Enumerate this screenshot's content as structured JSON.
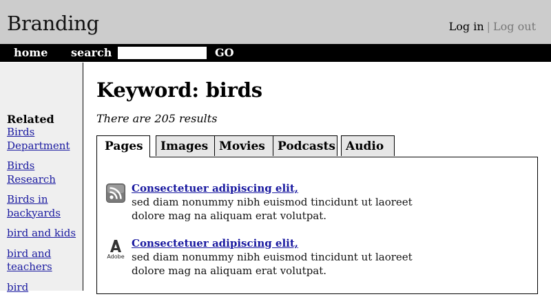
{
  "header": {
    "brand": "Branding",
    "login_label": "Log in",
    "separator": "|",
    "logout_label": "Log out"
  },
  "nav": {
    "home_label": "home",
    "search_label": "search",
    "search_value": "",
    "go_label": "GO"
  },
  "sidebar": {
    "title": "Related",
    "items": [
      {
        "label": "Birds Department"
      },
      {
        "label": "Birds Research"
      },
      {
        "label": "Birds in backyards"
      },
      {
        "label": "bird and kids"
      },
      {
        "label": "bird and teachers"
      },
      {
        "label": "bird"
      }
    ]
  },
  "main": {
    "title": "Keyword: birds",
    "results_count": "There are 205 results",
    "tabs": [
      {
        "label": "Pages"
      },
      {
        "label": "Images"
      },
      {
        "label": "Movies"
      },
      {
        "label": "Podcasts"
      },
      {
        "label": "Audio"
      }
    ],
    "results": [
      {
        "icon": "rss-icon",
        "title": "Consectetuer adipiscing elit,",
        "line1": "sed diam nonummy nibh euismod tincidunt ut laoreet",
        "line2": "dolore mag na aliquam erat volutpat."
      },
      {
        "icon": "adobe-pdf-icon",
        "icon_text": "Adobe",
        "title": "Consectetuer adipiscing elit,",
        "line1": "sed diam nonummy nibh euismod tincidunt ut laoreet",
        "line2": "dolore mag na aliquam erat volutpat."
      }
    ]
  },
  "colors": {
    "header_bg": "#cccccc",
    "nav_bg": "#000000",
    "sidebar_bg": "#efefef",
    "link": "#1a1aa0"
  }
}
